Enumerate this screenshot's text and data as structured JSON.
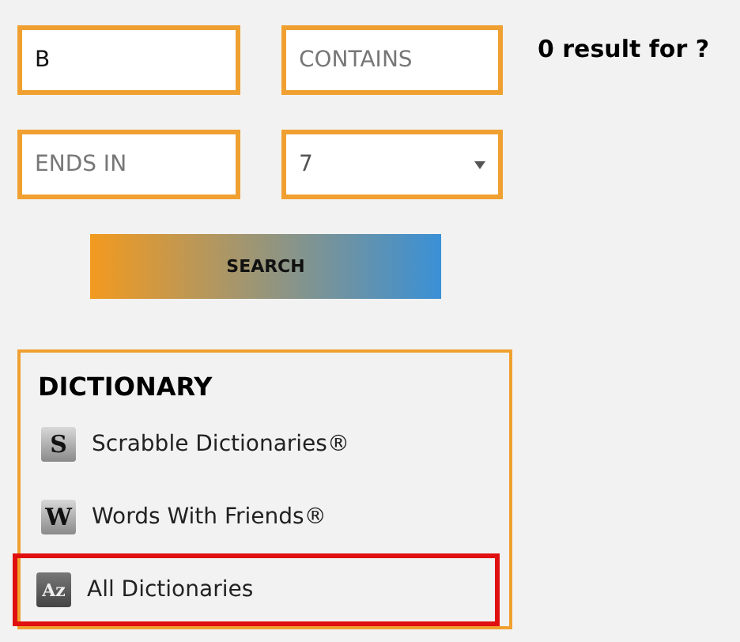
{
  "fields": [
    {
      "kind": "text",
      "value": "B"
    },
    {
      "kind": "text",
      "placeholder": "CONTAINS"
    },
    {
      "kind": "text",
      "placeholder": "ENDS IN"
    },
    {
      "kind": "select",
      "value": "7"
    }
  ],
  "result_text": "0 result for ?",
  "search_button": "SEARCH",
  "dictionary": {
    "title": "DICTIONARY",
    "items": [
      {
        "tile": "S",
        "label": "Scrabble Dictionaries®",
        "selected": false
      },
      {
        "tile": "W",
        "label": "Words With Friends®",
        "selected": false
      },
      {
        "tile": "Az",
        "label": "All Dictionaries",
        "selected": true
      }
    ]
  }
}
